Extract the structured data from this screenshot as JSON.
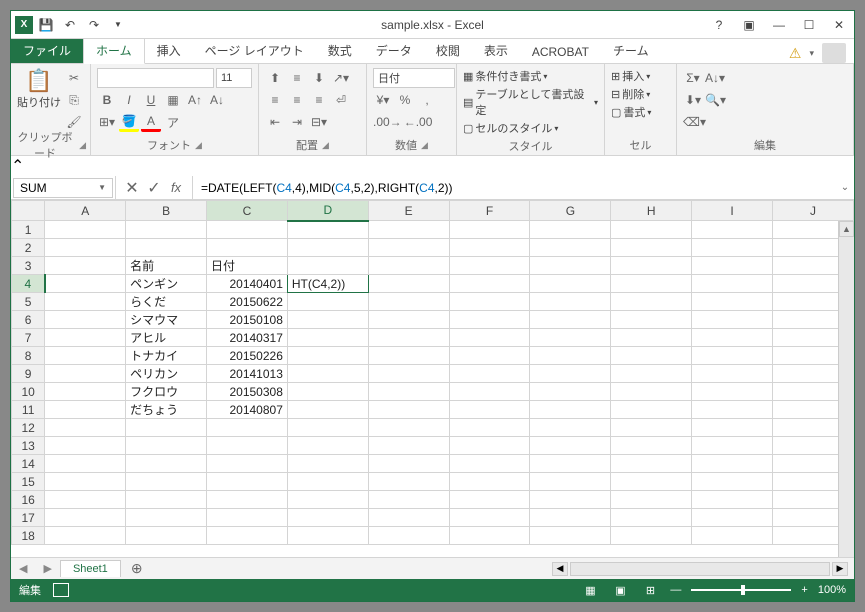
{
  "app": {
    "title": "sample.xlsx - Excel"
  },
  "tabs": {
    "file": "ファイル",
    "home": "ホーム",
    "insert": "挿入",
    "pagelayout": "ページ レイアウト",
    "formulas": "数式",
    "data": "データ",
    "review": "校閲",
    "view": "表示",
    "acrobat": "ACROBAT",
    "team": "チーム"
  },
  "ribbon": {
    "clipboard": {
      "label": "クリップボード",
      "paste": "貼り付け"
    },
    "font": {
      "label": "フォント",
      "size": "11"
    },
    "alignment": {
      "label": "配置"
    },
    "number": {
      "label": "数値",
      "format": "日付"
    },
    "styles": {
      "label": "スタイル",
      "conditional": "条件付き書式",
      "table": "テーブルとして書式設定",
      "cell": "セルのスタイル"
    },
    "cells": {
      "label": "セル",
      "insert": "挿入",
      "delete": "削除",
      "format": "書式"
    },
    "editing": {
      "label": "編集"
    }
  },
  "namebox": "SUM",
  "formula": {
    "prefix": "=DATE(LEFT(",
    "ref1": "C4",
    "mid1": ",4),MID(",
    "ref2": "C4",
    "mid2": ",5,2),RIGHT(",
    "ref3": "C4",
    "suffix": ",2))"
  },
  "columns": [
    "A",
    "B",
    "C",
    "D",
    "E",
    "F",
    "G",
    "H",
    "I",
    "J"
  ],
  "rows_visible": 18,
  "active_cell": {
    "row": 4,
    "col": "D"
  },
  "ref_cell": {
    "row": 4,
    "col": "C"
  },
  "data": {
    "B3": "名前",
    "C3": "日付",
    "B4": "ペンギン",
    "C4": "20140401",
    "D4": "HT(C4,2))",
    "B5": "らくだ",
    "C5": "20150622",
    "B6": "シマウマ",
    "C6": "20150108",
    "B7": "アヒル",
    "C7": "20140317",
    "B8": "トナカイ",
    "C8": "20150226",
    "B9": "ペリカン",
    "C9": "20141013",
    "B10": "フクロウ",
    "C10": "20150308",
    "B11": "だちょう",
    "C11": "20140807"
  },
  "sheet_tab": "Sheet1",
  "status": {
    "mode": "編集",
    "zoom": "100%"
  }
}
